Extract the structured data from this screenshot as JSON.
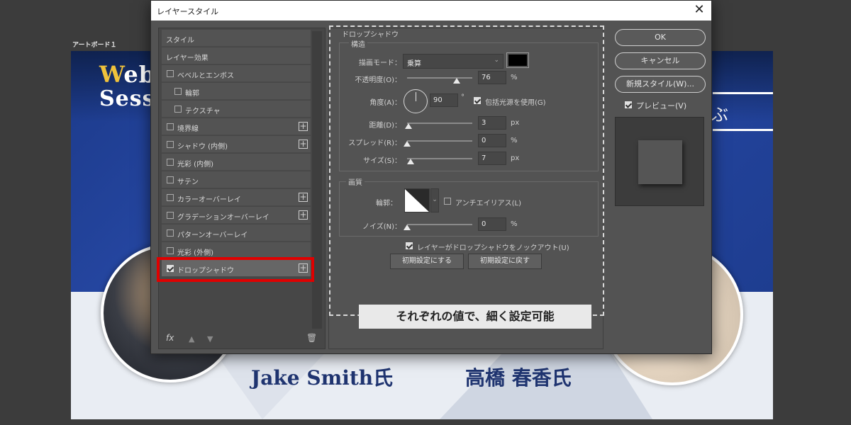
{
  "artboard": {
    "label": "アートボード１",
    "title_initial": "W",
    "title_line1_rest": "eb",
    "title_line2": "Sessi",
    "right_fragment": "ぶ",
    "speaker_left": "Jake Smith氏",
    "speaker_right": "高橋 春香氏"
  },
  "dialog": {
    "title": "レイヤースタイル",
    "close_glyph": "✕"
  },
  "style_list": {
    "items": [
      {
        "label": "スタイル"
      },
      {
        "label": "レイヤー効果"
      },
      {
        "label": "ベベルとエンボス"
      },
      {
        "label": "輪郭"
      },
      {
        "label": "テクスチャ"
      },
      {
        "label": "境界線"
      },
      {
        "label": "シャドウ (内側)"
      },
      {
        "label": "光彩 (内側)"
      },
      {
        "label": "サテン"
      },
      {
        "label": "カラーオーバーレイ"
      },
      {
        "label": "グラデーションオーバーレイ"
      },
      {
        "label": "パターンオーバーレイ"
      },
      {
        "label": "光彩 (外側)"
      },
      {
        "label": "ドロップシャドウ"
      }
    ],
    "fx_label": "fx"
  },
  "drop_shadow": {
    "group_title": "ドロップシャドウ",
    "structure_title": "構造",
    "blend_mode_label": "描画モード：",
    "blend_mode_value": "乗算",
    "opacity_label": "不透明度(O)：",
    "opacity_value": "76",
    "opacity_percent": 76,
    "angle_label": "角度(A)：",
    "angle_value": "90",
    "angle_unit": "°",
    "global_light_label": "包括光源を使用(G)",
    "distance_label": "距離(D)：",
    "distance_value": "3",
    "spread_label": "スプレッド(R)：",
    "spread_value": "0",
    "size_label": "サイズ(S)：",
    "size_value": "7",
    "quality_title": "画質",
    "contour_label": "輪郭：",
    "antialias_label": "アンチエイリアス(L)",
    "noise_label": "ノイズ(N)：",
    "noise_value": "0",
    "knockout_label": "レイヤーがドロップシャドウをノックアウト(U)",
    "make_default_label": "初期設定にする",
    "reset_default_label": "初期設定に戻す",
    "unit_percent": "%",
    "unit_px": "px",
    "shadow_color": "#000000"
  },
  "caption": "それぞれの値で、細く設定可能",
  "actions": {
    "ok": "OK",
    "cancel": "キャンセル",
    "new_style": "新規スタイル(W)...",
    "preview": "プレビュー(V)"
  }
}
